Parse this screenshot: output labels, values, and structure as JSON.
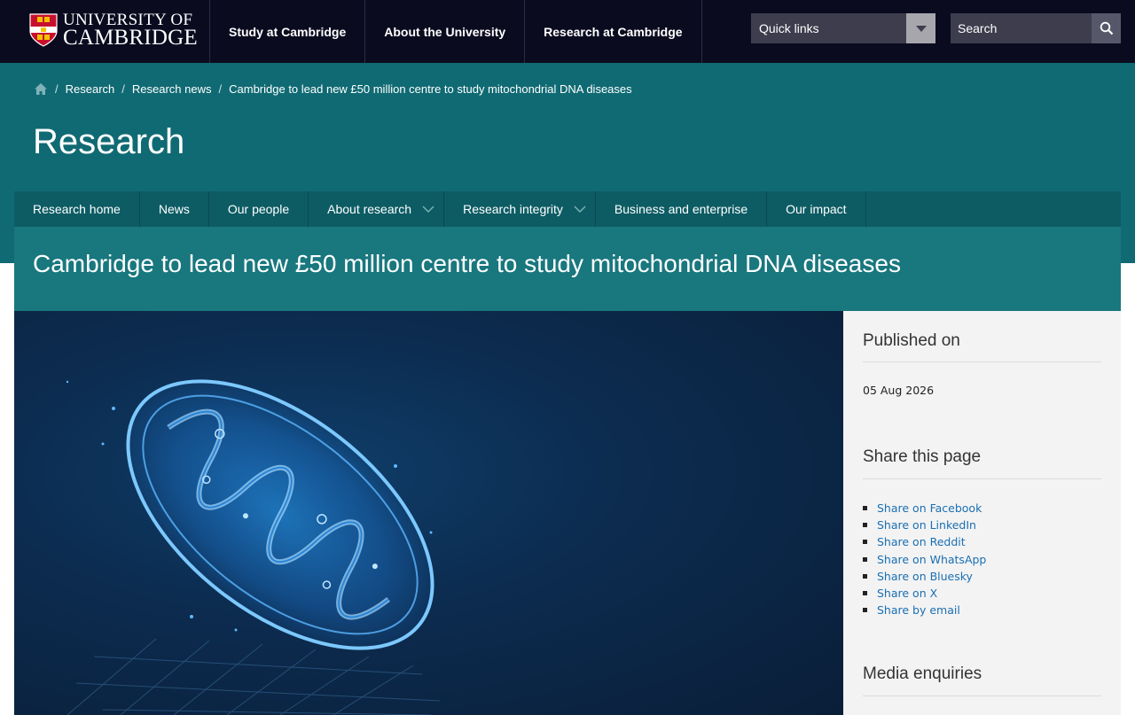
{
  "header": {
    "logo": {
      "line1": "UNIVERSITY OF",
      "line2": "CAMBRIDGE"
    },
    "nav": [
      "Study at Cambridge",
      "About the University",
      "Research at Cambridge"
    ],
    "quick_links_label": "Quick links",
    "search_placeholder": "Search"
  },
  "breadcrumb": {
    "items": [
      "Research",
      "Research news",
      "Cambridge to lead new £50 million centre to study mitochondrial DNA diseases"
    ]
  },
  "section_title": "Research",
  "subnav": {
    "items": [
      {
        "label": "Research home"
      },
      {
        "label": "News"
      },
      {
        "label": "Our people"
      },
      {
        "label": "About research"
      },
      {
        "label": "Research integrity"
      },
      {
        "label": "Business and enterprise"
      },
      {
        "label": "Our impact"
      }
    ]
  },
  "article": {
    "title": "Cambridge to lead new £50 million centre to study mitochondrial DNA diseases"
  },
  "sidebar": {
    "published_heading": "Published on",
    "published_date": "05 Aug 2026",
    "share_heading": "Share this page",
    "share_links": [
      "Share on Facebook",
      "Share on LinkedIn",
      "Share on Reddit",
      "Share on WhatsApp",
      "Share on Bluesky",
      "Share on X",
      "Share by email"
    ],
    "media_heading": "Media enquiries"
  },
  "colors": {
    "header_bg": "#0b0b20",
    "teal_band": "#106a73",
    "article_band": "#19777e",
    "link": "#1a6fb2"
  }
}
